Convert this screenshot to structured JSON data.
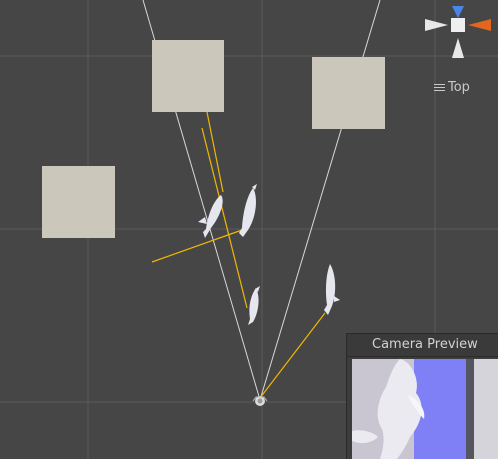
{
  "scene_view": {
    "orientation_label": "Top",
    "colors": {
      "background": "#464646",
      "grid": "#5a5a5a",
      "cube": "#cbc8bb",
      "ray": "#f0b800",
      "frustum": "#d8d8d8",
      "gizmo_x": "#e3661f",
      "gizmo_y": "#4a86e8"
    }
  },
  "camera_preview": {
    "title": "Camera Preview",
    "colors": {
      "sky": "#7f80f5",
      "floor": "#c9c5d1",
      "fish": "#e6e6ef"
    }
  }
}
